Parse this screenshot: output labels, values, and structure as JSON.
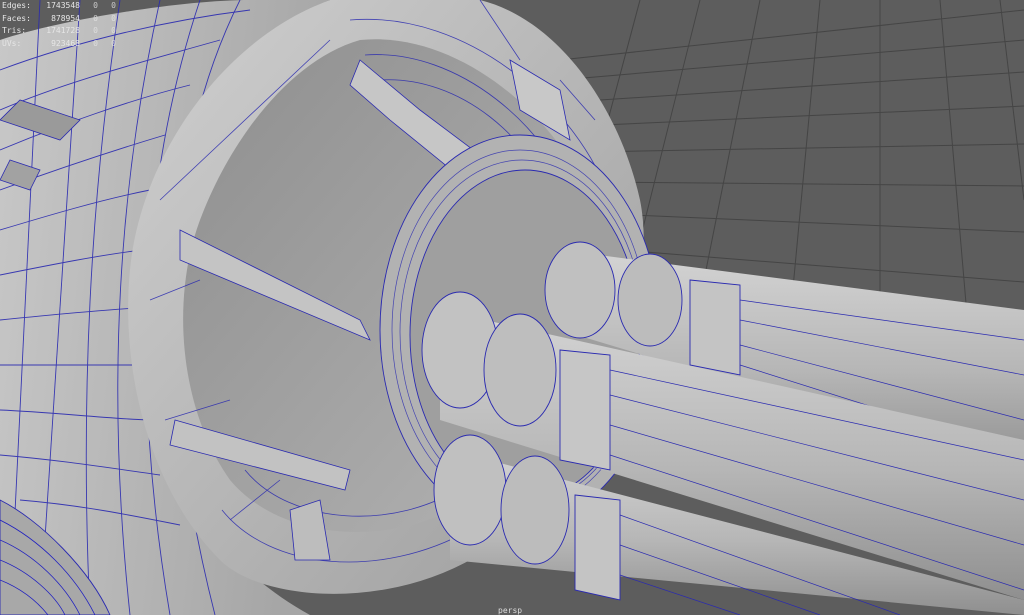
{
  "viewport": {
    "background": "#5d5d5d",
    "wire_color": "#2a2ab0",
    "grid_color": "#3e3e3e",
    "surface_color": "#b9b9b9"
  },
  "hud": {
    "rows": [
      {
        "label": "Edges:",
        "value": "1743548",
        "col2": "0",
        "col3": "0"
      },
      {
        "label": "Faces:",
        "value": "878954",
        "col2": "0",
        "col3": "0"
      },
      {
        "label": "Tris:",
        "value": "1741728",
        "col2": "0",
        "col3": "0"
      },
      {
        "label": "UVs:",
        "value": "923468",
        "col2": "0",
        "col3": "0"
      }
    ]
  },
  "camera_label": "persp"
}
